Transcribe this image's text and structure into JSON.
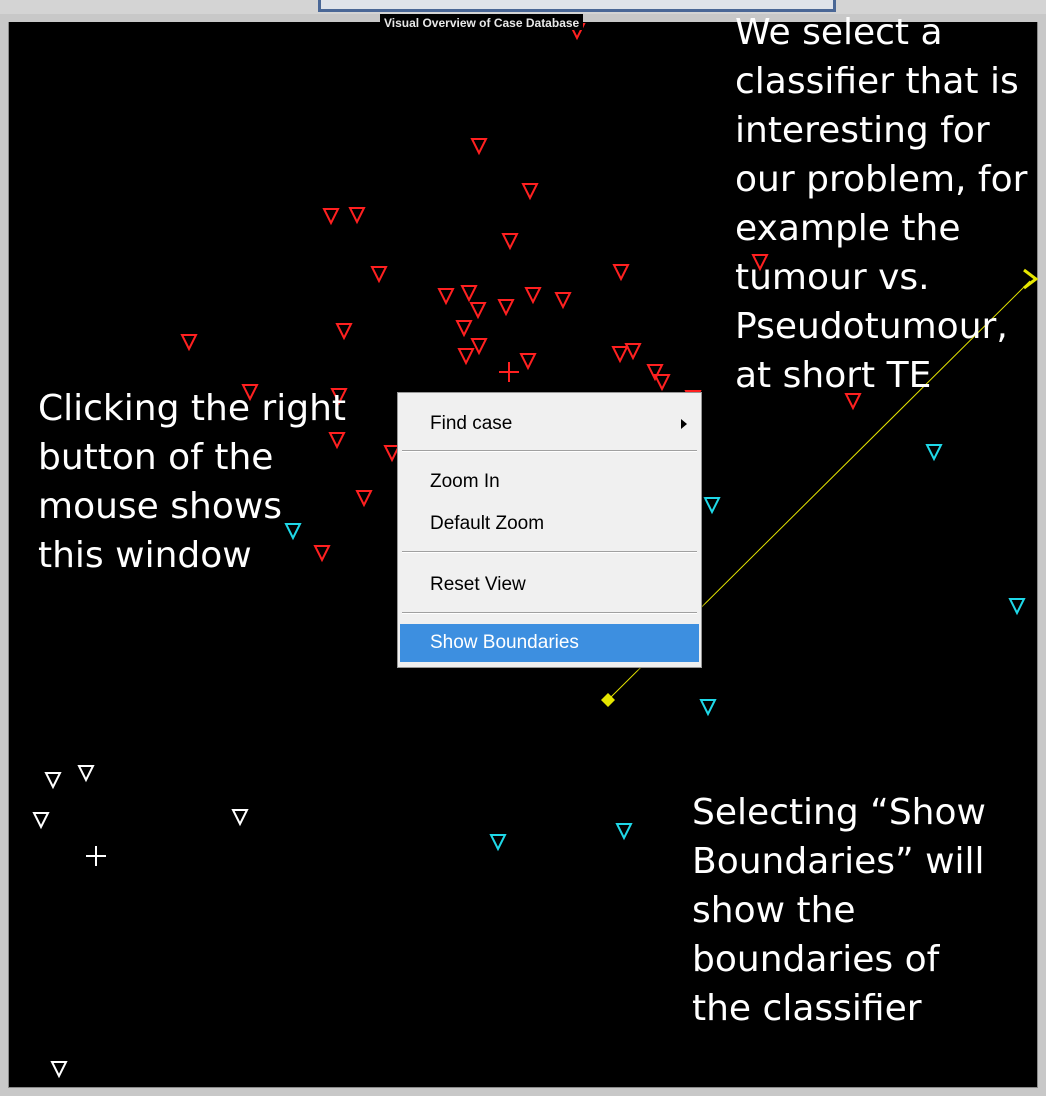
{
  "panel": {
    "title": "Visual Overview of Case Database"
  },
  "annotations": {
    "left": "Clicking the right\nbutton of the\nmouse shows\nthis window",
    "right": "We select a\nclassifier that is\ninteresting for\nour problem, for\nexample the\ntumour vs.\nPseudotumour,\nat short TE",
    "bottom": "Selecting “Show\nBoundaries” will\nshow the\nboundaries of\nthe classifier"
  },
  "context_menu": {
    "items": [
      {
        "label": "Find case",
        "has_submenu": true
      },
      {
        "label": "Zoom In"
      },
      {
        "label": "Default Zoom"
      },
      {
        "label": "Reset View"
      },
      {
        "label": "Show Boundaries",
        "selected": true
      }
    ]
  },
  "colors": {
    "background": "#000000",
    "class_red": "#ff2020",
    "class_cyan": "#1fd8e8",
    "class_white": "#ffffff",
    "classifier_line": "#e6e600",
    "menu_highlight": "#3d8fe0"
  },
  "icons": {
    "case_marker": "triangle-down-icon",
    "centroid_marker": "plus-icon",
    "line_start": "diamond-icon",
    "line_end": "chevron-right-icon",
    "submenu": "chevron-right-icon"
  }
}
